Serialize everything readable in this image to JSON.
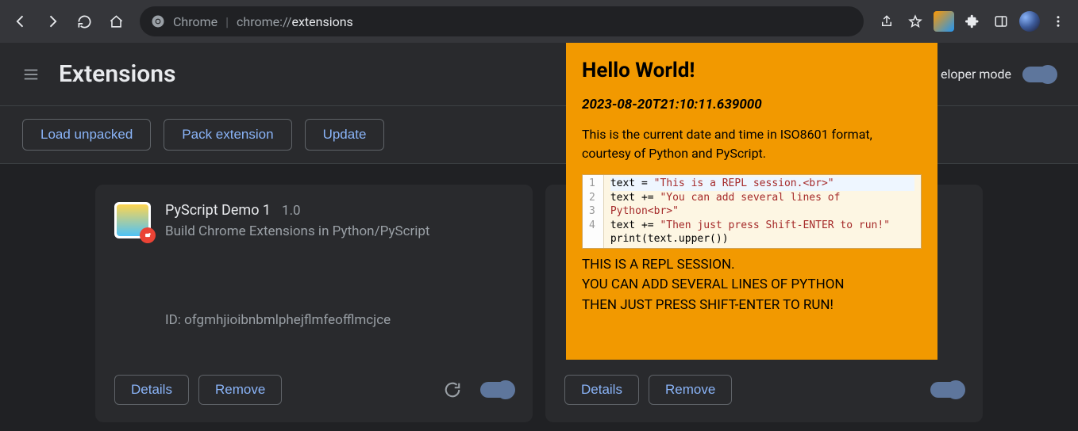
{
  "browser": {
    "product": "Chrome",
    "separator": " | ",
    "url_prefix": "chrome://",
    "url_path": "extensions"
  },
  "header": {
    "title": "Extensions",
    "dev_mode_label": "eloper mode"
  },
  "toolbar": {
    "load_unpacked": "Load unpacked",
    "pack_extension": "Pack extension",
    "update": "Update"
  },
  "cards": [
    {
      "name": "PyScript Demo 1",
      "version": "1.0",
      "description": "Build Chrome Extensions in Python/PyScript",
      "id_label": "ID: ofgmhjioibnbmlphejflmfeofflmcjce",
      "details": "Details",
      "remove": "Remove"
    },
    {
      "details": "Details",
      "remove": "Remove"
    }
  ],
  "popup": {
    "title": "Hello World!",
    "timestamp": "2023-08-20T21:10:11.639000",
    "body": "This is the current date and time in ISO8601 format, courtesy of Python and PyScript.",
    "code": {
      "gutter": [
        "1",
        "2",
        "3",
        "4"
      ],
      "l1_a": "text = ",
      "l1_b": "\"This is a REPL session.<br>\"",
      "l2_a": "text += ",
      "l2_b": "\"You can add several lines of Python<br>\"",
      "l3_a": "text += ",
      "l3_b": "\"Then just press Shift-ENTER to run!\"",
      "l4": "print(text.upper())"
    },
    "output_l1": "THIS IS A REPL SESSION.",
    "output_l2": "YOU CAN ADD SEVERAL LINES OF PYTHON",
    "output_l3": "THEN JUST PRESS SHIFT-ENTER TO RUN!"
  }
}
